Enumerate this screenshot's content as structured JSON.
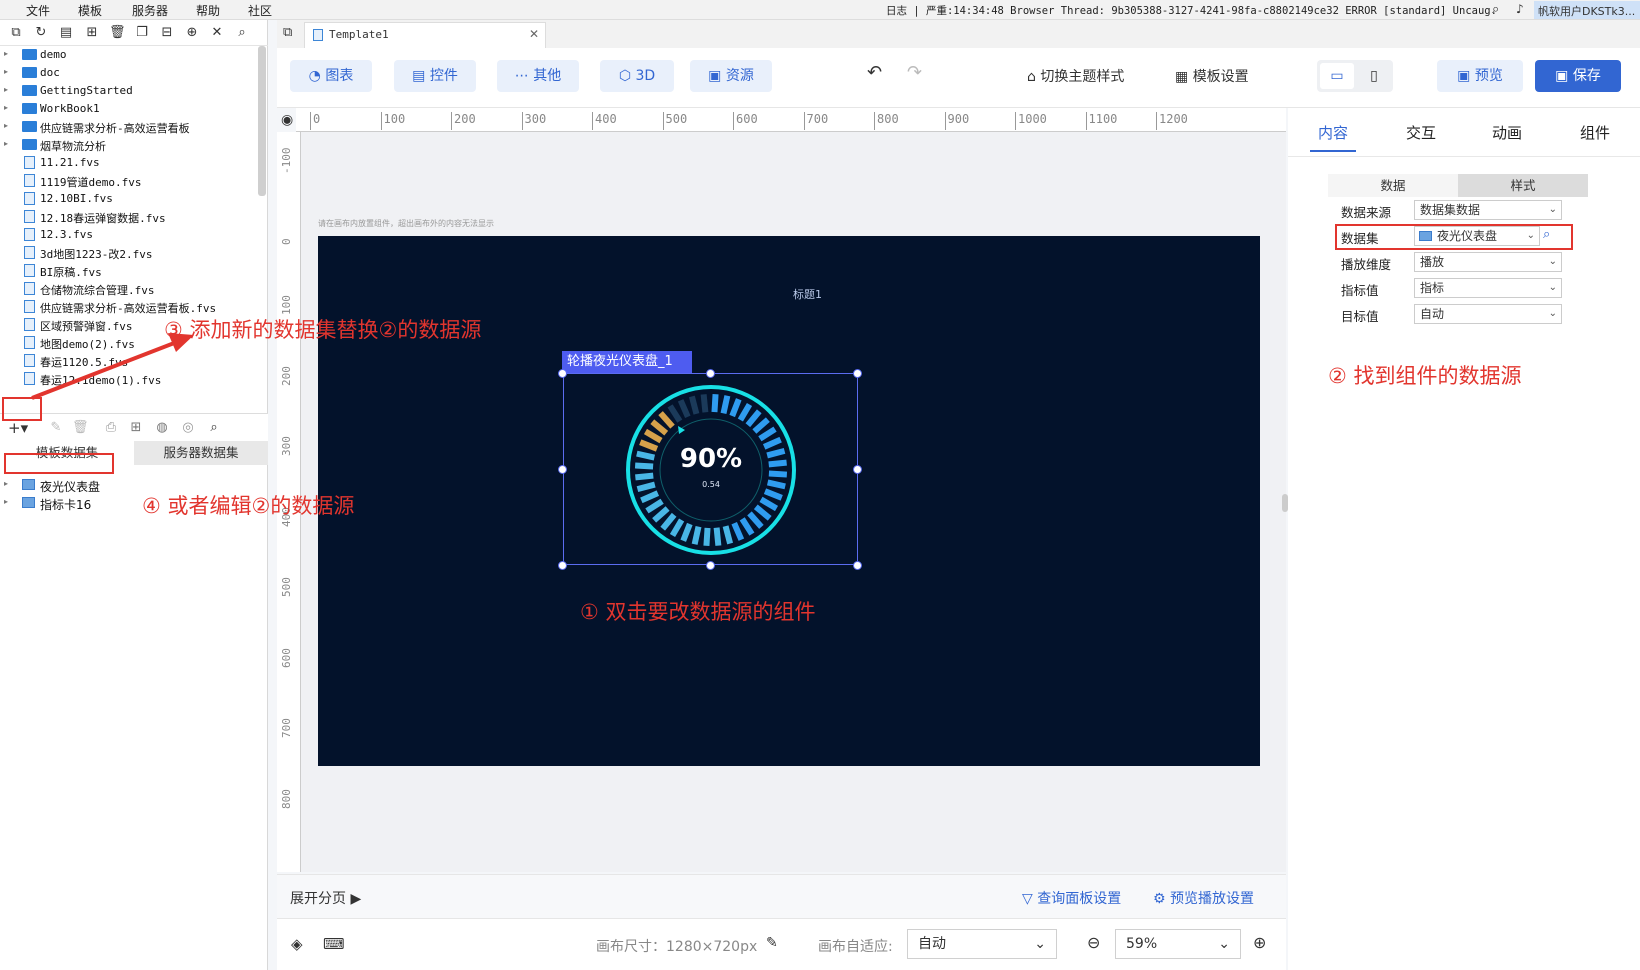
{
  "menubar": {
    "items": [
      "文件",
      "模板",
      "服务器",
      "帮助",
      "社区"
    ],
    "status": "日志 | 严重:14:34:48 Browser Thread: 9b305388-3127-4241-98fa-c8802149ce32 ERROR [standard] Uncaug...",
    "user": "帆软用户DKSTk3..."
  },
  "tree": {
    "items": [
      {
        "label": "demo",
        "type": "folder"
      },
      {
        "label": "doc",
        "type": "folder"
      },
      {
        "label": "GettingStarted",
        "type": "folder"
      },
      {
        "label": "WorkBook1",
        "type": "folder"
      },
      {
        "label": "供应链需求分析-高效运营看板",
        "type": "folder"
      },
      {
        "label": "烟草物流分析",
        "type": "folder"
      },
      {
        "label": "11.21.fvs",
        "type": "file"
      },
      {
        "label": "1119管道demo.fvs",
        "type": "file"
      },
      {
        "label": "12.10BI.fvs",
        "type": "file"
      },
      {
        "label": "12.18春运弹窗数据.fvs",
        "type": "file"
      },
      {
        "label": "12.3.fvs",
        "type": "file"
      },
      {
        "label": "3d地图1223-改2.fvs",
        "type": "file"
      },
      {
        "label": "BI原稿.fvs",
        "type": "file"
      },
      {
        "label": "仓储物流综合管理.fvs",
        "type": "file"
      },
      {
        "label": "供应链需求分析-高效运营看板.fvs",
        "type": "file"
      },
      {
        "label": "区域预警弹窗.fvs",
        "type": "file"
      },
      {
        "label": "地图demo(2).fvs",
        "type": "file"
      },
      {
        "label": "春运1120.5.fvs",
        "type": "file"
      },
      {
        "label": "春运12.1demo(1).fvs",
        "type": "file"
      }
    ]
  },
  "datasets": {
    "tabs": [
      "模板数据集",
      "服务器数据集"
    ],
    "items": [
      "夜光仪表盘",
      "指标卡16"
    ]
  },
  "editor": {
    "tab_title": "Template1",
    "toolbar": {
      "chart": "图表",
      "widget": "控件",
      "other": "其他",
      "3d": "3D",
      "resource": "资源",
      "theme": "切换主题样式",
      "template_settings": "模板设置",
      "preview": "预览",
      "save": "保存"
    },
    "ruler_h": [
      "0",
      "100",
      "200",
      "300",
      "400",
      "500",
      "600",
      "700",
      "800",
      "900",
      "1000",
      "1100",
      "1200"
    ],
    "ruler_v": [
      "-100",
      "0",
      "100",
      "200",
      "300",
      "400",
      "500",
      "600",
      "700",
      "800"
    ],
    "canvas_hint": "请在画布内放置组件，超出画布外的内容无法显示",
    "canvas_title": "标题1",
    "widget_label": "轮播夜光仪表盘_1",
    "gauge": {
      "percent_text": "90%",
      "value_text": "0.54",
      "fraction": 0.9
    }
  },
  "right_panel": {
    "tabs": [
      "内容",
      "交互",
      "动画",
      "组件"
    ],
    "subtabs": [
      "数据",
      "样式"
    ],
    "props": [
      {
        "label": "数据来源",
        "value": "数据集数据"
      },
      {
        "label": "数据集",
        "value": "夜光仪表盘"
      },
      {
        "label": "播放维度",
        "value": "播放"
      },
      {
        "label": "指标值",
        "value": "指标"
      },
      {
        "label": "目标值",
        "value": "自动"
      }
    ]
  },
  "page_bar": {
    "expand": "展开分页",
    "query_settings": "查询面板设置",
    "preview_settings": "预览播放设置"
  },
  "status_bar": {
    "canvas_size": "画布尺寸：1280×720px",
    "fit_label": "画布自适应:",
    "fit_value": "自动",
    "zoom": "59%"
  },
  "annotations": {
    "step1": "① 双击要改数据源的组件",
    "step2": "② 找到组件的数据源",
    "step3": "③ 添加新的数据集替换②的数据源",
    "step4": "④ 或者编辑②的数据源"
  },
  "colors": {
    "accent": "#3266d2",
    "annotation": "#e2352e",
    "canvas": "#03122b",
    "gauge_ring": "#18e0e6"
  }
}
